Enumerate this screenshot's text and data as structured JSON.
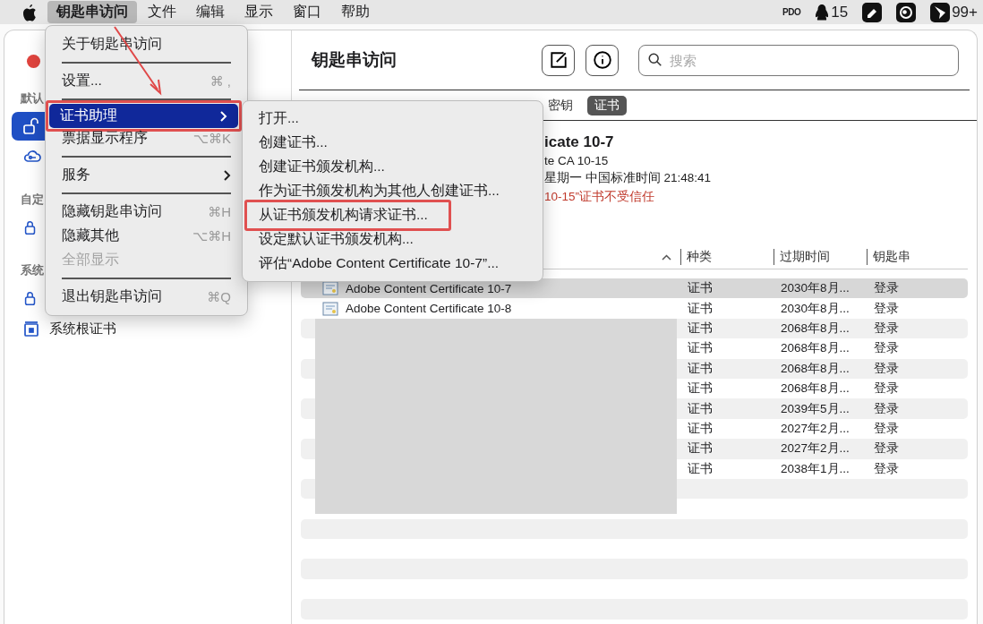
{
  "menubar": {
    "menus": [
      {
        "label": "钥匙串访问",
        "selected": true
      },
      {
        "label": "文件",
        "selected": false
      },
      {
        "label": "编辑",
        "selected": false
      },
      {
        "label": "显示",
        "selected": false
      },
      {
        "label": "窗口",
        "selected": false
      },
      {
        "label": "帮助",
        "selected": false
      }
    ],
    "status_items": [
      {
        "kind": "logo",
        "label": "PDO"
      },
      {
        "kind": "penguin",
        "label": "15"
      },
      {
        "kind": "pen"
      },
      {
        "kind": "ring"
      },
      {
        "kind": "bird",
        "label": "99+"
      }
    ]
  },
  "app_menu": {
    "items": [
      {
        "kind": "item",
        "label": "关于钥匙串访问",
        "selected": false,
        "disabled": false,
        "submenu": false,
        "highlighted": false
      },
      {
        "kind": "separator"
      },
      {
        "kind": "item",
        "label": "设置...",
        "shortcut": "⌘ ,",
        "selected": false,
        "disabled": false,
        "submenu": false,
        "highlighted": false
      },
      {
        "kind": "separator"
      },
      {
        "kind": "item",
        "label": "证书助理",
        "selected": true,
        "disabled": false,
        "submenu": true,
        "highlighted": true
      },
      {
        "kind": "item",
        "label": "票据显示程序",
        "shortcut": "⌥⌘K",
        "selected": false,
        "disabled": false,
        "submenu": false,
        "highlighted": false
      },
      {
        "kind": "separator"
      },
      {
        "kind": "item",
        "label": "服务",
        "selected": false,
        "disabled": false,
        "submenu": true,
        "highlighted": false
      },
      {
        "kind": "separator"
      },
      {
        "kind": "item",
        "label": "隐藏钥匙串访问",
        "shortcut": "⌘H",
        "selected": false,
        "disabled": false,
        "submenu": false,
        "highlighted": false
      },
      {
        "kind": "item",
        "label": "隐藏其他",
        "shortcut": "⌥⌘H",
        "selected": false,
        "disabled": false,
        "submenu": false,
        "highlighted": false
      },
      {
        "kind": "item",
        "label": "全部显示",
        "selected": false,
        "disabled": true,
        "submenu": false,
        "highlighted": false
      },
      {
        "kind": "separator"
      },
      {
        "kind": "item",
        "label": "退出钥匙串访问",
        "shortcut": "⌘Q",
        "selected": false,
        "disabled": false,
        "submenu": false,
        "highlighted": false
      }
    ]
  },
  "submenu": {
    "items": [
      {
        "label": "打开...",
        "highlighted": false
      },
      {
        "label": "创建证书...",
        "highlighted": false
      },
      {
        "label": "创建证书颁发机构...",
        "highlighted": false
      },
      {
        "label": "作为证书颁发机构为其他人创建证书...",
        "highlighted": false
      },
      {
        "label": "从证书颁发机构请求证书...",
        "highlighted": true
      },
      {
        "label": "设定默认证书颁发机构...",
        "highlighted": false
      },
      {
        "label": "评估“Adobe Content Certificate 10-7”...",
        "highlighted": false
      }
    ]
  },
  "sidebar": {
    "sections": [
      {
        "label": "默认",
        "items": [
          {
            "kind": "unlocked",
            "selected": true
          },
          {
            "kind": "cloud",
            "selected": false
          }
        ]
      },
      {
        "label": "自定",
        "items": [
          {
            "kind": "lock",
            "selected": false
          }
        ]
      },
      {
        "label": "系统",
        "items": [
          {
            "kind": "lock",
            "selected": false
          },
          {
            "kind": "cabinet",
            "label": "系统根证书",
            "selected": false
          }
        ]
      }
    ]
  },
  "main": {
    "title": "钥匙串访问",
    "search": {
      "placeholder": "搜索"
    },
    "tabs": [
      {
        "label": "密钥",
        "selected": false
      },
      {
        "label": "证书",
        "selected": true
      }
    ],
    "detail": {
      "name": "icate 10-7",
      "issuer": "te CA 10-15",
      "expires": "星期一 中国标准时间 21:48:41",
      "warning": "10-15”证书不受信任"
    },
    "table": {
      "sort_ascending": true,
      "redacted": true,
      "columns": [
        "种类",
        "过期时间",
        "钥匙串"
      ],
      "rows": [
        {
          "name": "Adobe Content Certificate 10-7",
          "kind": "证书",
          "expires": "2030年8月...",
          "keychain": "登录",
          "selected": true
        },
        {
          "name": "Adobe Content Certificate 10-8",
          "kind": "证书",
          "expires": "2030年8月...",
          "keychain": "登录",
          "selected": false
        },
        {
          "kind": "证书",
          "expires": "2068年8月...",
          "keychain": "登录",
          "selected": false
        },
        {
          "kind": "证书",
          "expires": "2068年8月...",
          "keychain": "登录",
          "selected": false
        },
        {
          "kind": "证书",
          "expires": "2068年8月...",
          "keychain": "登录",
          "selected": false
        },
        {
          "kind": "证书",
          "expires": "2068年8月...",
          "keychain": "登录",
          "selected": false
        },
        {
          "kind": "证书",
          "expires": "2039年5月...",
          "keychain": "登录",
          "selected": false
        },
        {
          "kind": "证书",
          "expires": "2027年2月...",
          "keychain": "登录",
          "selected": false
        },
        {
          "kind": "证书",
          "expires": "2027年2月...",
          "keychain": "登录",
          "selected": false
        },
        {
          "kind": "证书",
          "expires": "2038年1月...",
          "keychain": "登录",
          "selected": false
        }
      ]
    }
  }
}
